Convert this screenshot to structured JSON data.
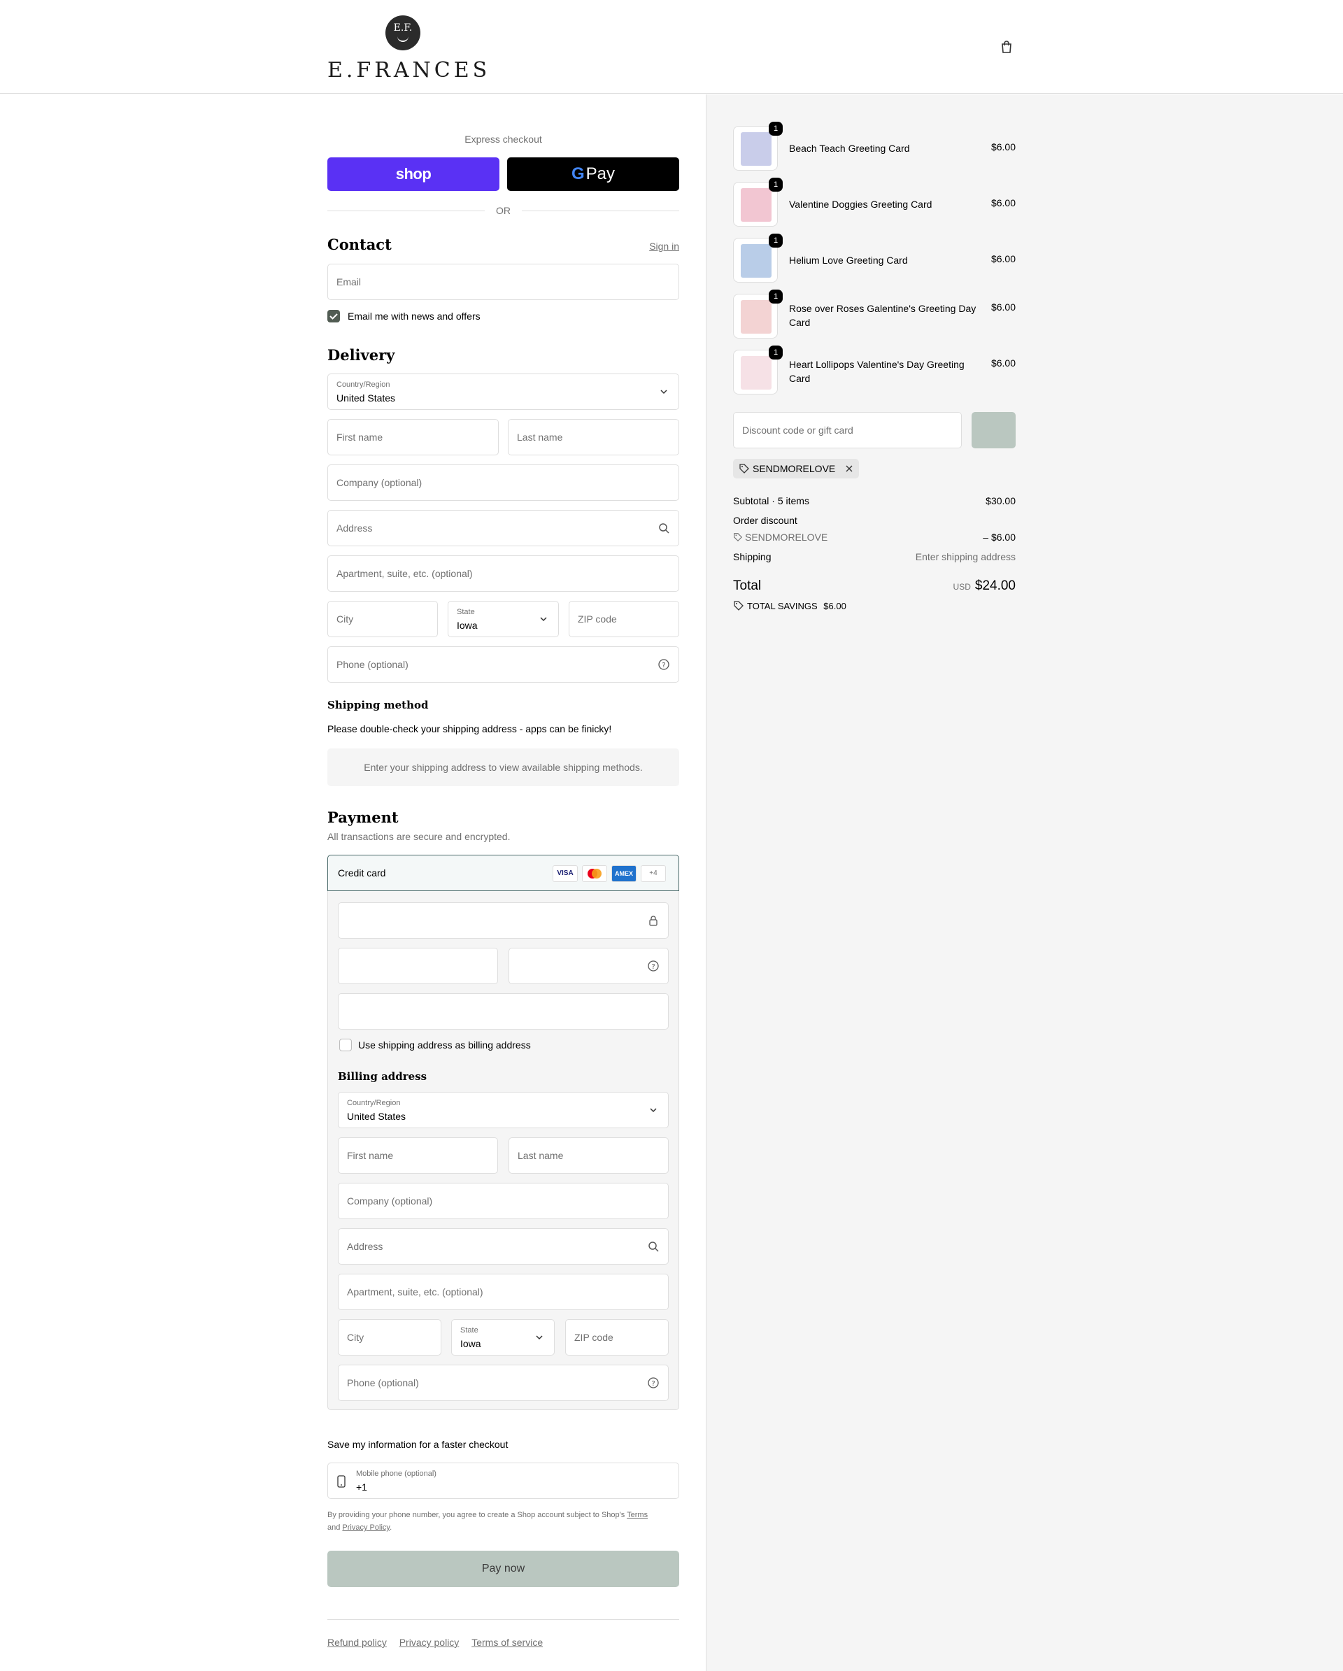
{
  "brand": {
    "name": "E.FRANCES",
    "badge": "E.F."
  },
  "express": {
    "title": "Express checkout",
    "shop_label": "shop",
    "gpay_g": "G",
    "gpay_label": "Pay",
    "or": "OR"
  },
  "contact": {
    "title": "Contact",
    "sign_in": "Sign in",
    "email_placeholder": "Email",
    "news_label": "Email me with news and offers",
    "news_checked": true
  },
  "delivery": {
    "title": "Delivery",
    "country_label": "Country/Region",
    "country": "United States",
    "first_name": "First name",
    "last_name": "Last name",
    "company": "Company (optional)",
    "address": "Address",
    "apartment": "Apartment, suite, etc. (optional)",
    "city": "City",
    "state_label": "State",
    "state": "Iowa",
    "zip": "ZIP code",
    "phone": "Phone (optional)"
  },
  "shipping": {
    "title": "Shipping method",
    "note": "Please double-check your shipping address - apps can be finicky!",
    "placeholder": "Enter your shipping address to view available shipping methods."
  },
  "payment": {
    "title": "Payment",
    "subtitle": "All transactions are secure and encrypted.",
    "method": "Credit card",
    "card_logos": [
      "VISA",
      "mastercard",
      "AMEX",
      "+4"
    ],
    "billing_same_label": "Use shipping address as billing address",
    "billing_same_checked": false
  },
  "billing": {
    "title": "Billing address",
    "country_label": "Country/Region",
    "country": "United States",
    "first_name": "First name",
    "last_name": "Last name",
    "company": "Company (optional)",
    "address": "Address",
    "apartment": "Apartment, suite, etc. (optional)",
    "city": "City",
    "state_label": "State",
    "state": "Iowa",
    "zip": "ZIP code",
    "phone": "Phone (optional)"
  },
  "save_info": {
    "title": "Save my information for a faster checkout",
    "mobile_label": "Mobile phone (optional)",
    "mobile_value": "+1",
    "legal_prefix": "By providing your phone number, you agree to create a Shop account subject to Shop's",
    "terms": "Terms",
    "and": "and",
    "privacy": "Privacy Policy",
    "period": "."
  },
  "pay_now": "Pay now",
  "footer": {
    "links": [
      "Refund policy",
      "Privacy policy",
      "Terms of service"
    ]
  },
  "order": {
    "items": [
      {
        "name": "Beach Teach Greeting Card",
        "price": "$6.00",
        "qty": "1",
        "color": "#c9cdea"
      },
      {
        "name": "Valentine Doggies Greeting Card",
        "price": "$6.00",
        "qty": "1",
        "color": "#f2c6d2"
      },
      {
        "name": "Helium Love Greeting Card",
        "price": "$6.00",
        "qty": "1",
        "color": "#b9cde8"
      },
      {
        "name": "Rose over Roses Galentine's Greeting Day Card",
        "price": "$6.00",
        "qty": "1",
        "color": "#f3d3d3"
      },
      {
        "name": "Heart Lollipops Valentine's Day Greeting Card",
        "price": "$6.00",
        "qty": "1",
        "color": "#f6e1e6"
      }
    ],
    "discount_placeholder": "Discount code or gift card",
    "applied_code": "SENDMORELOVE",
    "subtotal_label": "Subtotal · 5 items",
    "subtotal": "$30.00",
    "order_discount_label": "Order discount",
    "discount_code": "SENDMORELOVE",
    "discount_amount": "– $6.00",
    "shipping_label": "Shipping",
    "shipping_value": "Enter shipping address",
    "total_label": "Total",
    "currency": "USD",
    "total": "$24.00",
    "savings_label": "TOTAL SAVINGS",
    "savings": "$6.00"
  }
}
